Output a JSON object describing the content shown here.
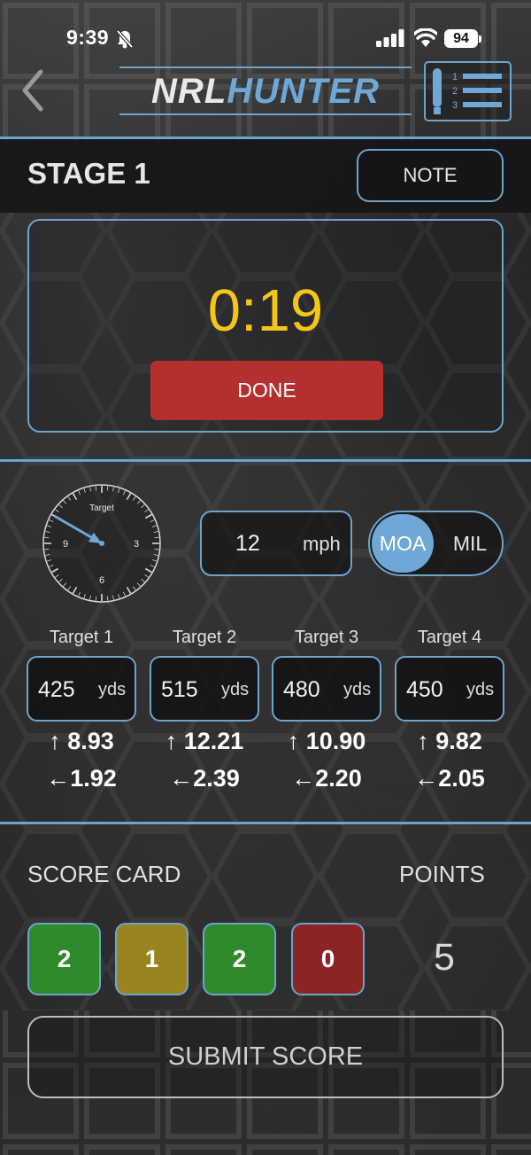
{
  "status_bar": {
    "time": "9:39",
    "battery": "94"
  },
  "header": {
    "logo_part1": "NRL",
    "logo_part2": "HUNTER",
    "menu_icon_numbers": [
      "1",
      "2",
      "3"
    ]
  },
  "stage": {
    "title": "STAGE 1",
    "note_label": "NOTE"
  },
  "timer": {
    "value": "0:19",
    "done_label": "DONE"
  },
  "wind": {
    "clock_label": "Target",
    "clock_numbers": [
      "3",
      "6",
      "9"
    ],
    "clock_direction_oclock": 10,
    "speed": "12",
    "speed_unit": "mph",
    "unit_options": [
      "MOA",
      "MIL"
    ],
    "selected_unit": "MOA"
  },
  "targets": [
    {
      "label": "Target 1",
      "range": "425",
      "unit": "yds",
      "elevation": "8.93",
      "windage": "1.92"
    },
    {
      "label": "Target 2",
      "range": "515",
      "unit": "yds",
      "elevation": "12.21",
      "windage": "2.39"
    },
    {
      "label": "Target 3",
      "range": "480",
      "unit": "yds",
      "elevation": "10.90",
      "windage": "2.20"
    },
    {
      "label": "Target 4",
      "range": "450",
      "unit": "yds",
      "elevation": "9.82",
      "windage": "2.05"
    }
  ],
  "arrows": {
    "up": "↑",
    "left": "←"
  },
  "score_card": {
    "title": "SCORE CARD",
    "points_title": "POINTS",
    "scores": [
      {
        "value": "2",
        "color": "#2f8a2c"
      },
      {
        "value": "1",
        "color": "#9a8420"
      },
      {
        "value": "2",
        "color": "#2f8a2c"
      },
      {
        "value": "0",
        "color": "#8b2424"
      }
    ],
    "points": "5",
    "submit_label": "SUBMIT SCORE"
  },
  "colors": {
    "accent": "#6fa3c9",
    "timer": "#f5c518",
    "done": "#b3302f",
    "toggle_active": "#6fa8d6"
  },
  "icons": [
    "back-chevron-icon",
    "silent-bell-icon",
    "signal-icon",
    "wifi-icon",
    "battery-icon",
    "scorecard-list-icon",
    "wind-clock-icon"
  ]
}
